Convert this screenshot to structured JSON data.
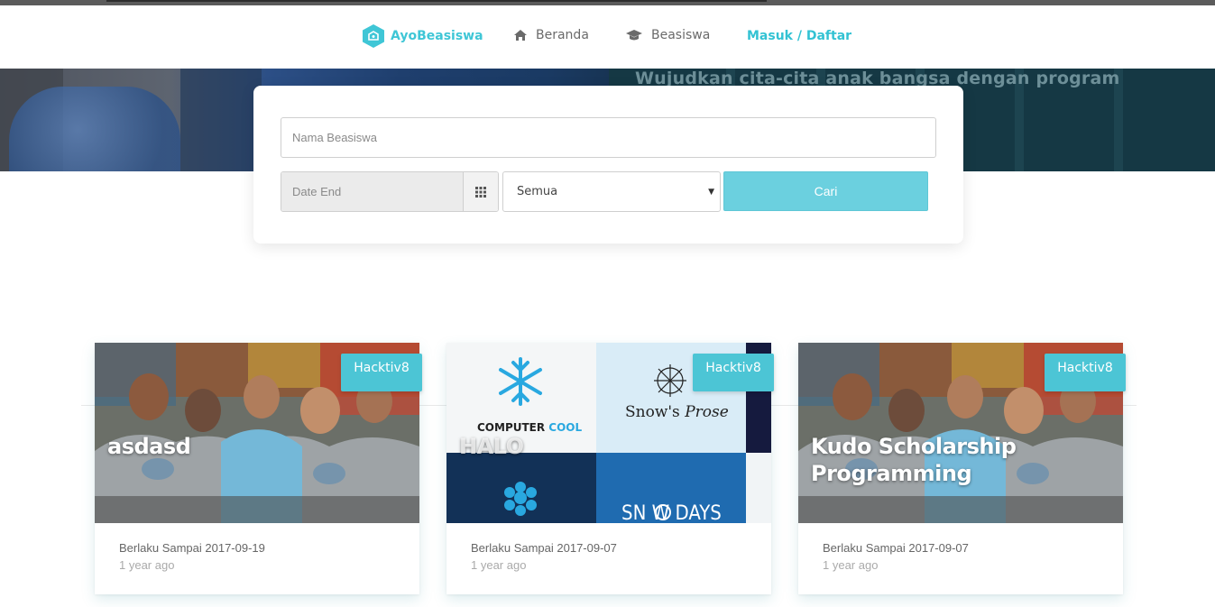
{
  "navbar": {
    "brand": "AyoBeasiswa",
    "items": [
      {
        "label": "Beranda",
        "icon": "home-icon"
      },
      {
        "label": "Beasiswa",
        "icon": "graduation-cap-icon"
      }
    ],
    "login": "Masuk / Daftar"
  },
  "hero": {
    "text": "Wujudkan cita-cita anak bangsa dengan program"
  },
  "search": {
    "name_placeholder": "Nama Beasiswa",
    "date_placeholder": "Date End",
    "category_selected": "Semua",
    "button_label": "Cari"
  },
  "cards": [
    {
      "title": "asdasd",
      "badge": "Hacktiv8",
      "date": "Berlaku Sampai 2017-09-19",
      "ago": "1 year ago"
    },
    {
      "title": "HALO",
      "badge": "Hacktiv8",
      "date": "Berlaku Sampai 2017-09-07",
      "ago": "1 year ago",
      "image_text": {
        "cool_a": "COMPUTER ",
        "cool_b": "COOL",
        "snow_a": "Snow's ",
        "snow_b": "Prose",
        "days": "SN  W DAYS"
      }
    },
    {
      "title": "Kudo Scholarship Programming",
      "badge": "Hacktiv8",
      "date": "Berlaku Sampai 2017-09-07",
      "ago": "1 year ago"
    }
  ],
  "colors": {
    "accent": "#3fc6d6",
    "button": "#6bd0df",
    "badge": "#4cc5d5"
  }
}
